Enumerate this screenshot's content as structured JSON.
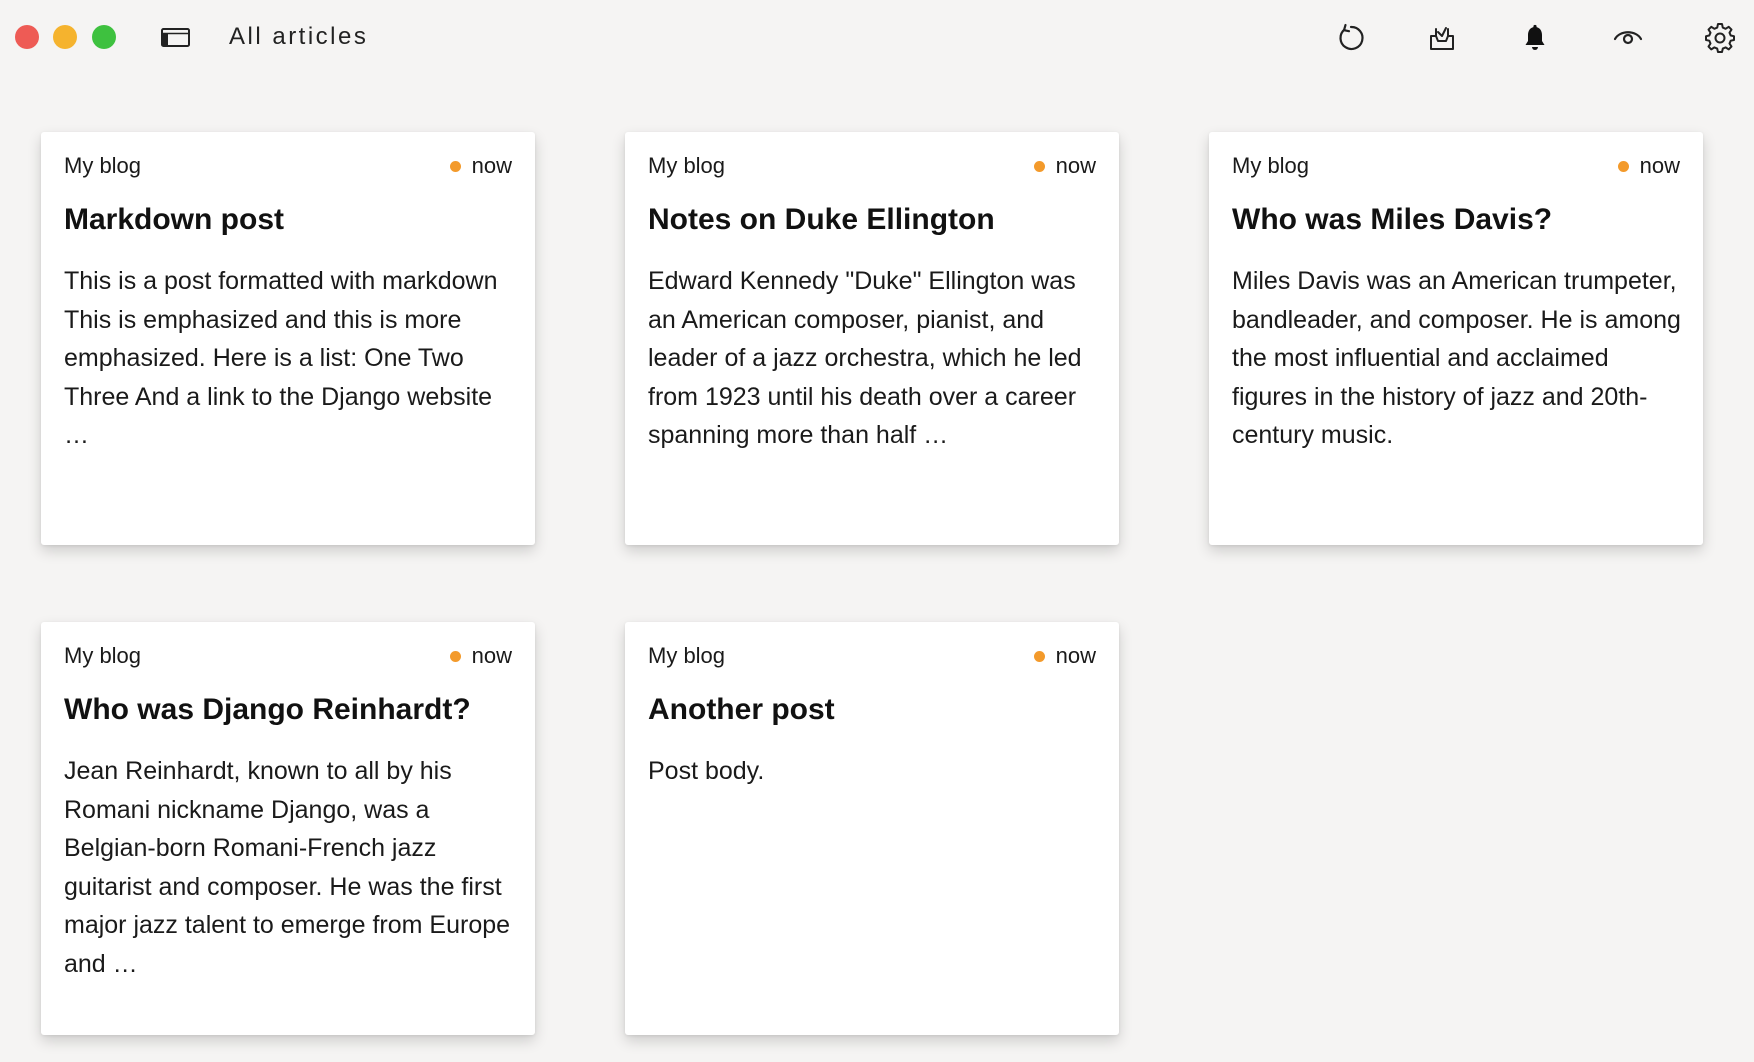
{
  "window": {
    "title": "All articles"
  },
  "toolbar": {
    "icons": [
      "refresh-icon",
      "inbox-icon",
      "bell-icon",
      "eye-icon",
      "gear-icon"
    ]
  },
  "colors": {
    "unread_dot": "#f39a2b",
    "background": "#f5f4f3",
    "card": "#ffffff"
  },
  "articles": [
    {
      "source": "My blog",
      "time": "now",
      "title": "Markdown post",
      "excerpt": "This is a post formatted with markdown This is emphasized and this is more emphasized. Here is a list: One Two Three And a link to the Django website …"
    },
    {
      "source": "My blog",
      "time": "now",
      "title": "Notes on Duke Ellington",
      "excerpt": "Edward Kennedy \"Duke\" Ellington was an American composer, pianist, and leader of a jazz orchestra, which he led from 1923 until his death over a career spanning more than half …"
    },
    {
      "source": "My blog",
      "time": "now",
      "title": "Who was Miles Davis?",
      "excerpt": "Miles Davis was an American trumpeter, bandleader, and composer. He is among the most influential and acclaimed figures in the history of jazz and 20th-century music."
    },
    {
      "source": "My blog",
      "time": "now",
      "title": "Who was Django Reinhardt?",
      "excerpt": "Jean Reinhardt, known to all by his Romani nickname Django, was a Belgian-born Romani-French jazz guitarist and composer. He was the first major jazz talent to emerge from Europe and …"
    },
    {
      "source": "My blog",
      "time": "now",
      "title": "Another post",
      "excerpt": "Post body."
    }
  ]
}
